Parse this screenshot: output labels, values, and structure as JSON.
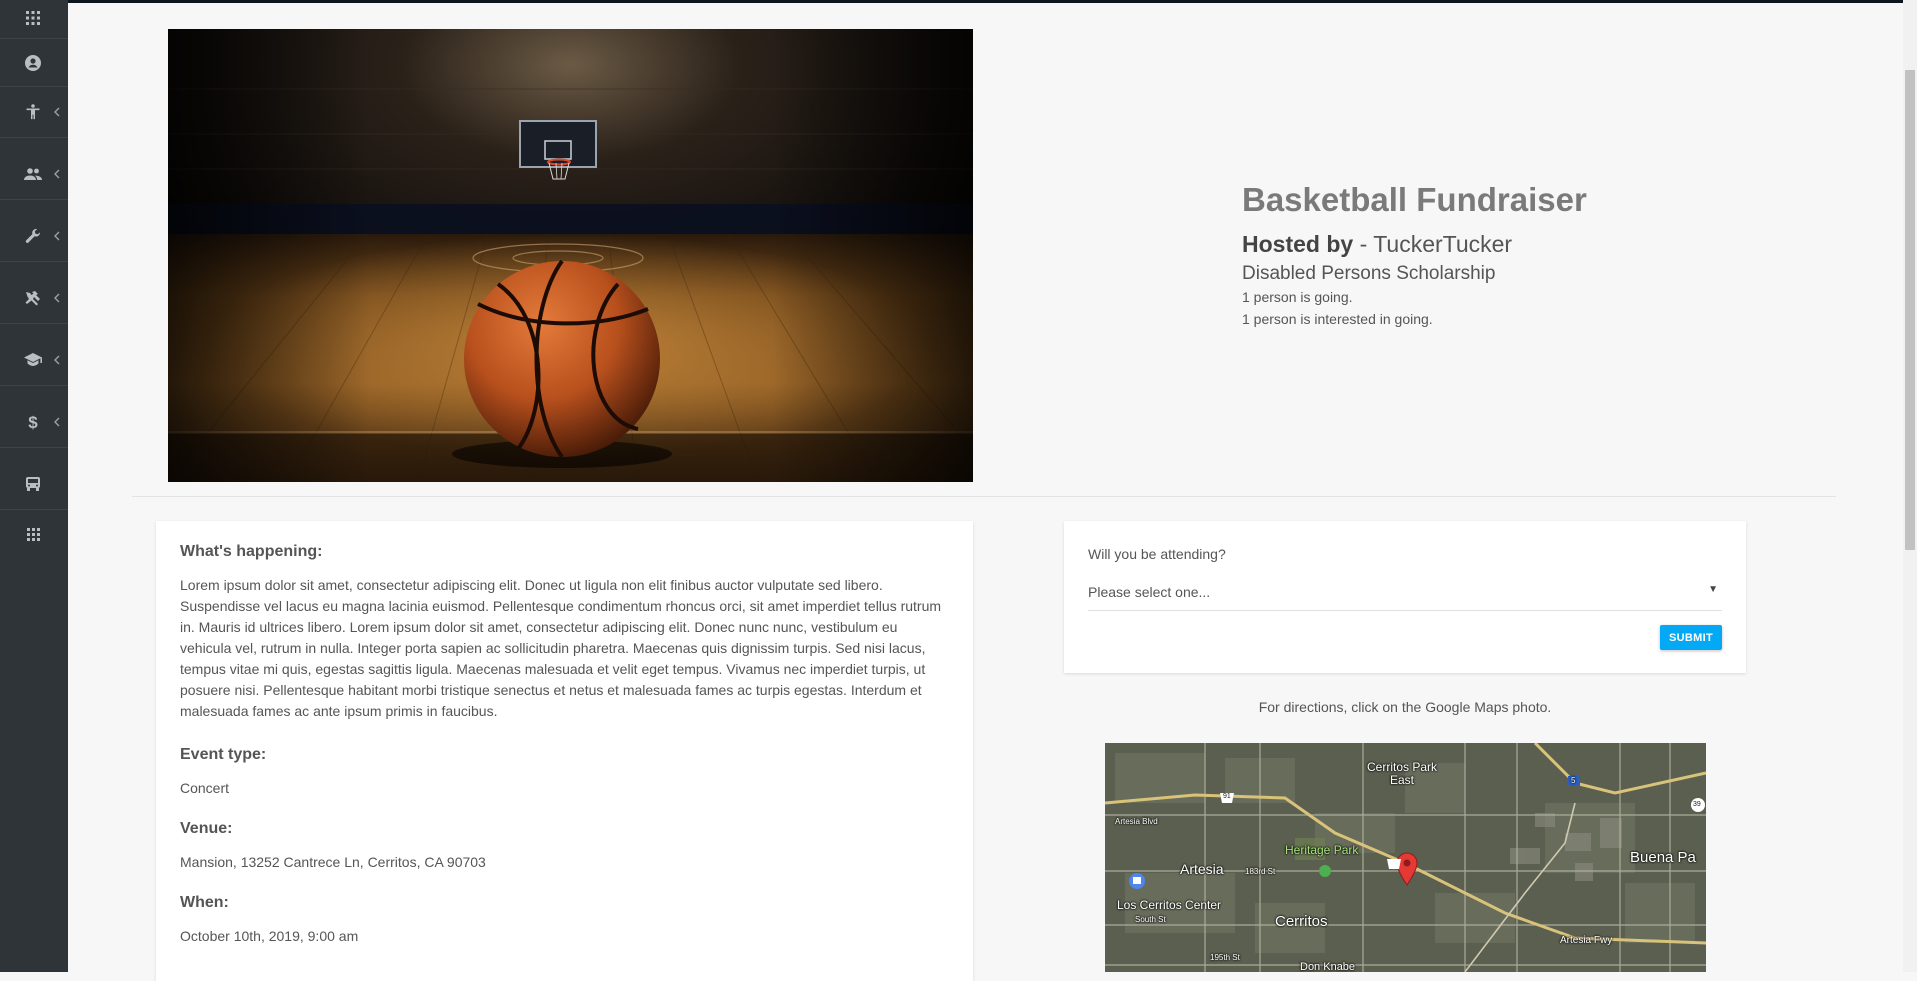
{
  "sidebar": {
    "items": [
      {
        "icon": "apps-grid-icon",
        "has_chevron": false
      },
      {
        "icon": "account-circle-icon",
        "has_chevron": false
      },
      {
        "icon": "accessibility-icon",
        "has_chevron": true
      },
      {
        "icon": "people-icon",
        "has_chevron": true
      },
      {
        "icon": "wrench-icon",
        "has_chevron": true
      },
      {
        "icon": "tools-icon",
        "has_chevron": true
      },
      {
        "icon": "graduation-cap-icon",
        "has_chevron": true
      },
      {
        "icon": "dollar-icon",
        "has_chevron": true
      },
      {
        "icon": "bus-icon",
        "has_chevron": false
      },
      {
        "icon": "grid-icon",
        "has_chevron": false
      }
    ]
  },
  "event": {
    "title": "Basketball Fundraiser",
    "hosted_by_label": "Hosted by",
    "host_separator": " - ",
    "host_name": "TuckerTucker",
    "organization": "Disabled Persons Scholarship",
    "going": "1 person is going.",
    "interested": "1 person is interested in going."
  },
  "details": {
    "whats_happening_label": "What's happening:",
    "description": "Lorem ipsum dolor sit amet, consectetur adipiscing elit. Donec ut ligula non elit finibus auctor vulputate sed libero. Suspendisse vel lacus eu magna lacinia euismod. Pellentesque condimentum rhoncus orci, sit amet imperdiet tellus rutrum in. Mauris id ultrices libero. Lorem ipsum dolor sit amet, consectetur adipiscing elit. Donec nunc nunc, vestibulum eu vehicula vel, rutrum in nulla. Integer porta sapien ac sollicitudin pharetra. Maecenas quis dignissim turpis. Sed nisi lacus, tempus vitae mi quis, egestas sagittis ligula. Maecenas malesuada et velit eget tempus. Vivamus nec imperdiet turpis, ut posuere nisi. Pellentesque habitant morbi tristique senectus et netus et malesuada fames ac turpis egestas. Interdum et malesuada fames ac ante ipsum primis in faucibus.",
    "event_type_label": "Event type:",
    "event_type": "Concert",
    "venue_label": "Venue:",
    "venue": "Mansion, 13252 Cantrece Ln, Cerritos, CA 90703",
    "when_label": "When:",
    "when": "October 10th, 2019, 9:00 am"
  },
  "rsvp": {
    "question": "Will you be attending?",
    "select_value": "Please select one...",
    "submit_label": "SUBMIT"
  },
  "directions_text": "For directions, click on the Google Maps photo.",
  "map_labels": {
    "cerritos_park_east": "Cerritos Park East",
    "heritage_park": "Heritage Park",
    "artesia": "Artesia",
    "los_cerritos_center": "Los Cerritos Center",
    "cerritos": "Cerritos",
    "buena_park": "Buena Pa",
    "artesia_blvd": "Artesia Blvd",
    "artesia_fwy": "Artesia Fwy",
    "183rd_st": "183rd St",
    "195th_st": "195th St",
    "south_st": "South St",
    "don_knabe": "Don Knabe",
    "route_91": "91",
    "route_5": "5",
    "route_39": "39"
  },
  "colors": {
    "sidebar_bg": "#2f3438",
    "accent": "#03a9f4",
    "page_bg": "#f7f7f7",
    "map_pin": "#e53935"
  }
}
